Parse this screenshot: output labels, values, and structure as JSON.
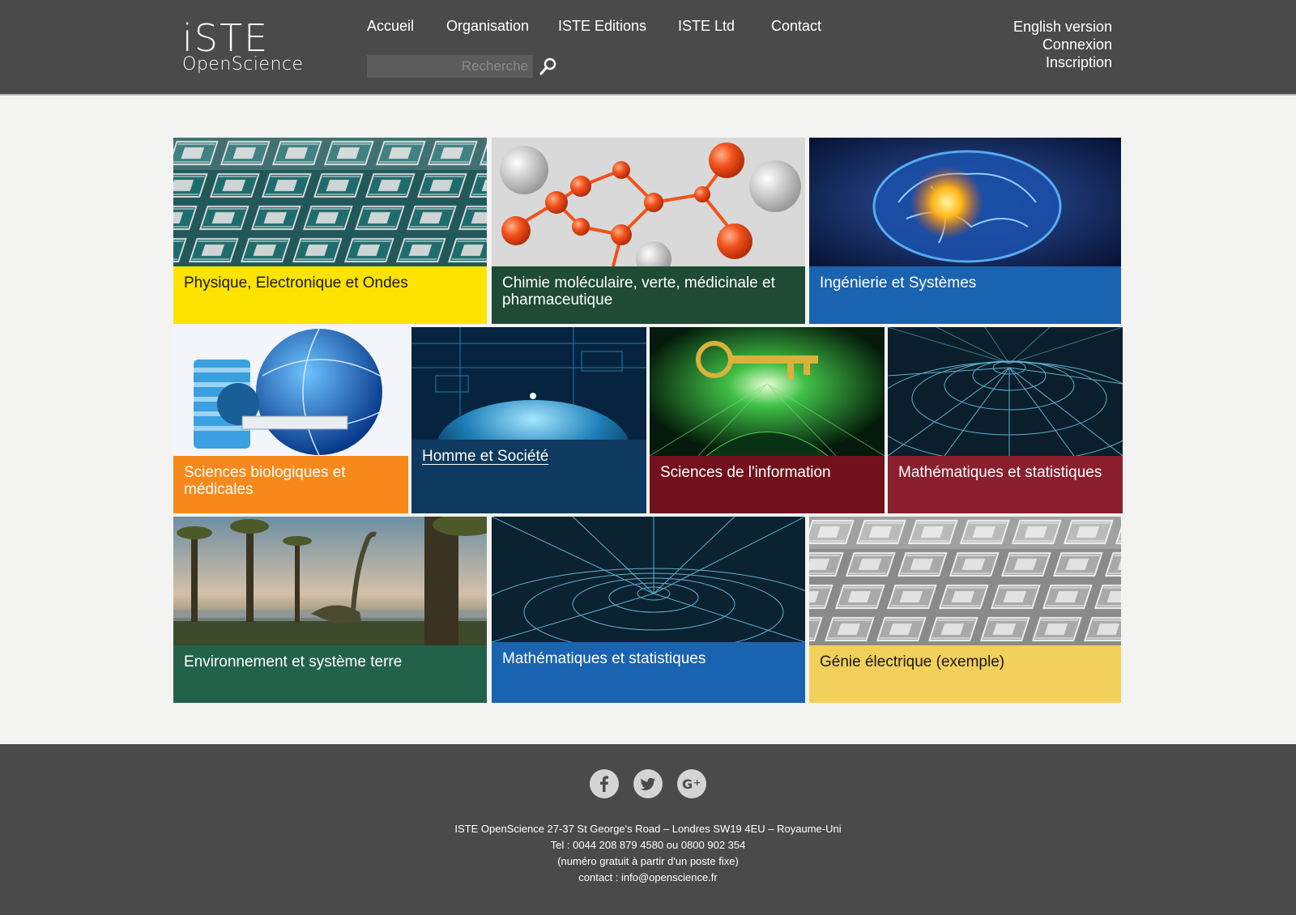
{
  "header": {
    "logo_top": "iSTE",
    "logo_bottom": "OpenScience",
    "nav": [
      "Accueil",
      "Organisation",
      "ISTE Editions",
      "ISTE Ltd",
      "Contact"
    ],
    "search_placeholder": "Recherche",
    "right_links": [
      "English version",
      "Connexion",
      "Inscription"
    ]
  },
  "tiles": [
    {
      "label": "Physique, Electronique et Ondes",
      "color": "#fce300",
      "text_color": "#1a1a1a",
      "icon": "chip-grid-image"
    },
    {
      "label": "Chimie moléculaire, verte, médicinale et pharmaceutique",
      "color": "#1f4b35",
      "text_color": "#ffffff",
      "icon": "molecule-image"
    },
    {
      "label": "Ingénierie et Systèmes",
      "color": "#1a63b0",
      "text_color": "#ffffff",
      "icon": "brain-image"
    },
    {
      "label": "Sciences biologiques et médicales",
      "color": "#f7891c",
      "text_color": "#ffffff",
      "icon": "scanner-globe-image"
    },
    {
      "label": "Homme et Société",
      "color": "#0d3a5e",
      "text_color": "#ffffff",
      "icon": "earth-network-image"
    },
    {
      "label": "Sciences de l'information",
      "color": "#72111b",
      "text_color": "#ffffff",
      "icon": "key-face-image"
    },
    {
      "label": "Mathématiques et statistiques",
      "color": "#8a1f2e",
      "text_color": "#ffffff",
      "icon": "wormhole-image"
    },
    {
      "label": "Environnement et système terre",
      "color": "#22624a",
      "text_color": "#ffffff",
      "icon": "dinosaur-image"
    },
    {
      "label": "Mathématiques et statistiques",
      "color": "#1a63b0",
      "text_color": "#ffffff",
      "icon": "wormhole-image"
    },
    {
      "label": "Génie électrique (exemple)",
      "color": "#f3cf5b",
      "text_color": "#1a1a1a",
      "icon": "chip-grid-gray-image"
    }
  ],
  "footer": {
    "social": [
      "facebook-icon",
      "twitter-icon",
      "google-plus-icon"
    ],
    "lines": [
      "ISTE OpenScience 27-37 St George's Road – Londres SW19 4EU – Royaume-Uni",
      "Tel : 0044 208 879 4580 ou 0800 902 354",
      "(numéro gratuit à partir d'un poste fixe)",
      "contact : info@openscience.fr"
    ]
  }
}
